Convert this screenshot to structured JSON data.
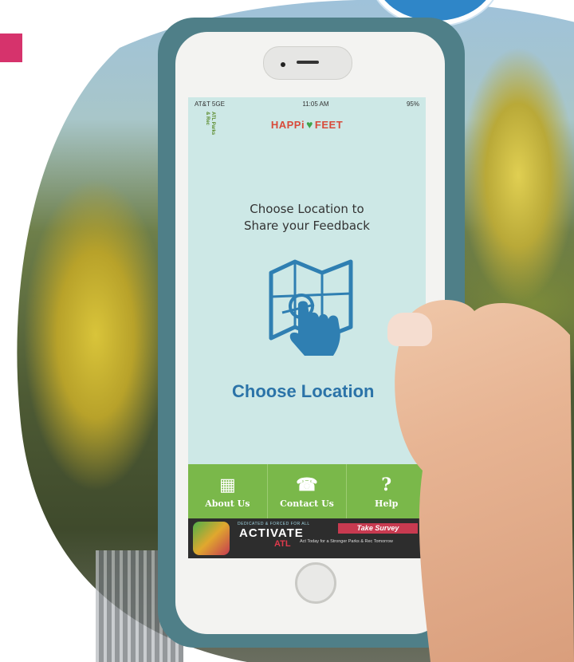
{
  "status_bar": {
    "carrier": "AT&T 5GE",
    "time": "11:05 AM",
    "battery": "95%"
  },
  "app": {
    "logo_text": "ATL Parks & Rec",
    "brand_left": "HAPPi",
    "brand_right": "FEET",
    "prompt_line1": "Choose Location to",
    "prompt_line2": "Share your Feedback",
    "map_icon": "map-touch-icon",
    "cta": "Choose Location"
  },
  "nav": [
    {
      "label": "About Us",
      "icon": "building-icon",
      "glyph": "▦"
    },
    {
      "label": "Contact Us",
      "icon": "phone-icon",
      "glyph": "☎"
    },
    {
      "label": "Help",
      "icon": "help-icon",
      "glyph": "?"
    }
  ],
  "banner": {
    "tagline": "DEDICATED & FORCED FOR ALL",
    "activate": "ACTIVATE",
    "atl": "ATL",
    "survey": "Take Survey",
    "subtext": "Act Today for a Stronger Parks & Rec Tomorrow"
  },
  "colors": {
    "screen_bg": "#cde8e6",
    "nav_green": "#7ab84a",
    "cta_blue": "#2b73a8",
    "brand_red": "#d84a3a",
    "phone_case": "#4f7f88"
  }
}
